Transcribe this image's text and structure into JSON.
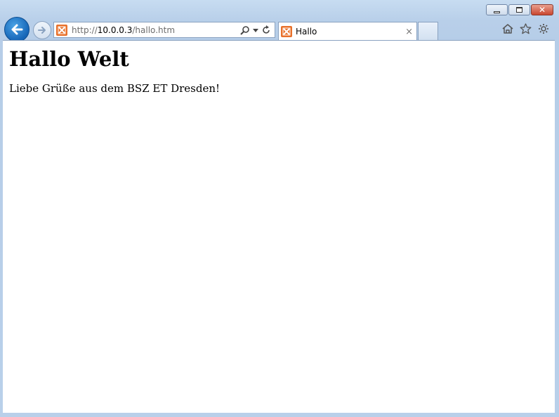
{
  "browser": {
    "url_prefix": "http://",
    "url_host": "10.0.0.3",
    "url_path": "/hallo.htm",
    "tab_title": "Hallo",
    "tab_close": "×",
    "window_close": "✕"
  },
  "page": {
    "heading": "Hallo Welt",
    "paragraph": "Liebe Grüße aus dem BSZ ET Dresden!"
  },
  "icons": {
    "back": "back-arrow-icon",
    "forward": "forward-arrow-icon",
    "favicon": "xampp-icon",
    "search": "search-icon",
    "dropdown": "chevron-down-icon",
    "refresh": "refresh-icon",
    "home": "home-icon",
    "favorites": "star-icon",
    "tools": "gear-icon"
  },
  "colors": {
    "accent": "#1565b7",
    "favicon": "#e8702a",
    "close": "#c9462f"
  }
}
